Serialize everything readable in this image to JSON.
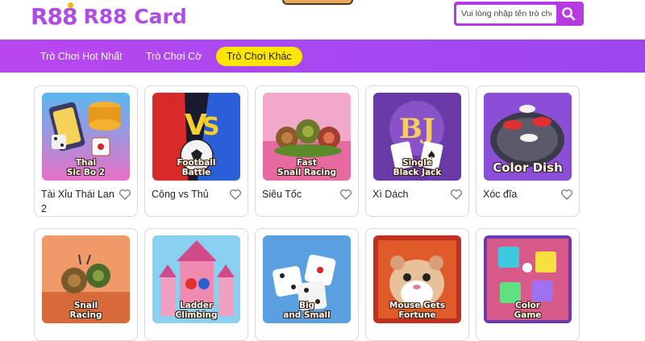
{
  "header": {
    "logo_mark": "R88",
    "logo_text": "R88 Card",
    "search_placeholder": "Vui lòng nhập tên trò chơi...",
    "search_icon": "search-icon"
  },
  "nav": {
    "items": [
      {
        "label": "Trò Chơi Hot Nhất",
        "active": false
      },
      {
        "label": "Trò Chơi Cờ",
        "active": false
      },
      {
        "label": "Trò Chơi Khác",
        "active": true
      }
    ]
  },
  "games": [
    {
      "name": "Tài Xỉu Thái Lan 2",
      "thumb_title": "Thai\nSic Bo 2"
    },
    {
      "name": "Công vs Thủ",
      "thumb_title": "Football\nBattle"
    },
    {
      "name": "Siêu Tốc",
      "thumb_title": "Fast\nSnail Racing"
    },
    {
      "name": "Xì Dách",
      "thumb_title": "Single\nBlack Jack"
    },
    {
      "name": "Xóc đĩa",
      "thumb_title": "Color Dish"
    },
    {
      "name": "",
      "thumb_title": "Snail\nRacing"
    },
    {
      "name": "",
      "thumb_title": "Ladder\nClimbing"
    },
    {
      "name": "",
      "thumb_title": "Big\nand Small"
    },
    {
      "name": "",
      "thumb_title": "Mouse Gets\nFortune"
    },
    {
      "name": "",
      "thumb_title": "Color\nGame"
    }
  ],
  "colors": {
    "brand_purple": "#b14be6",
    "nav_gradient_start": "#b947ee",
    "nav_gradient_end": "#9c46f0",
    "active_tab": "#ffe600"
  }
}
